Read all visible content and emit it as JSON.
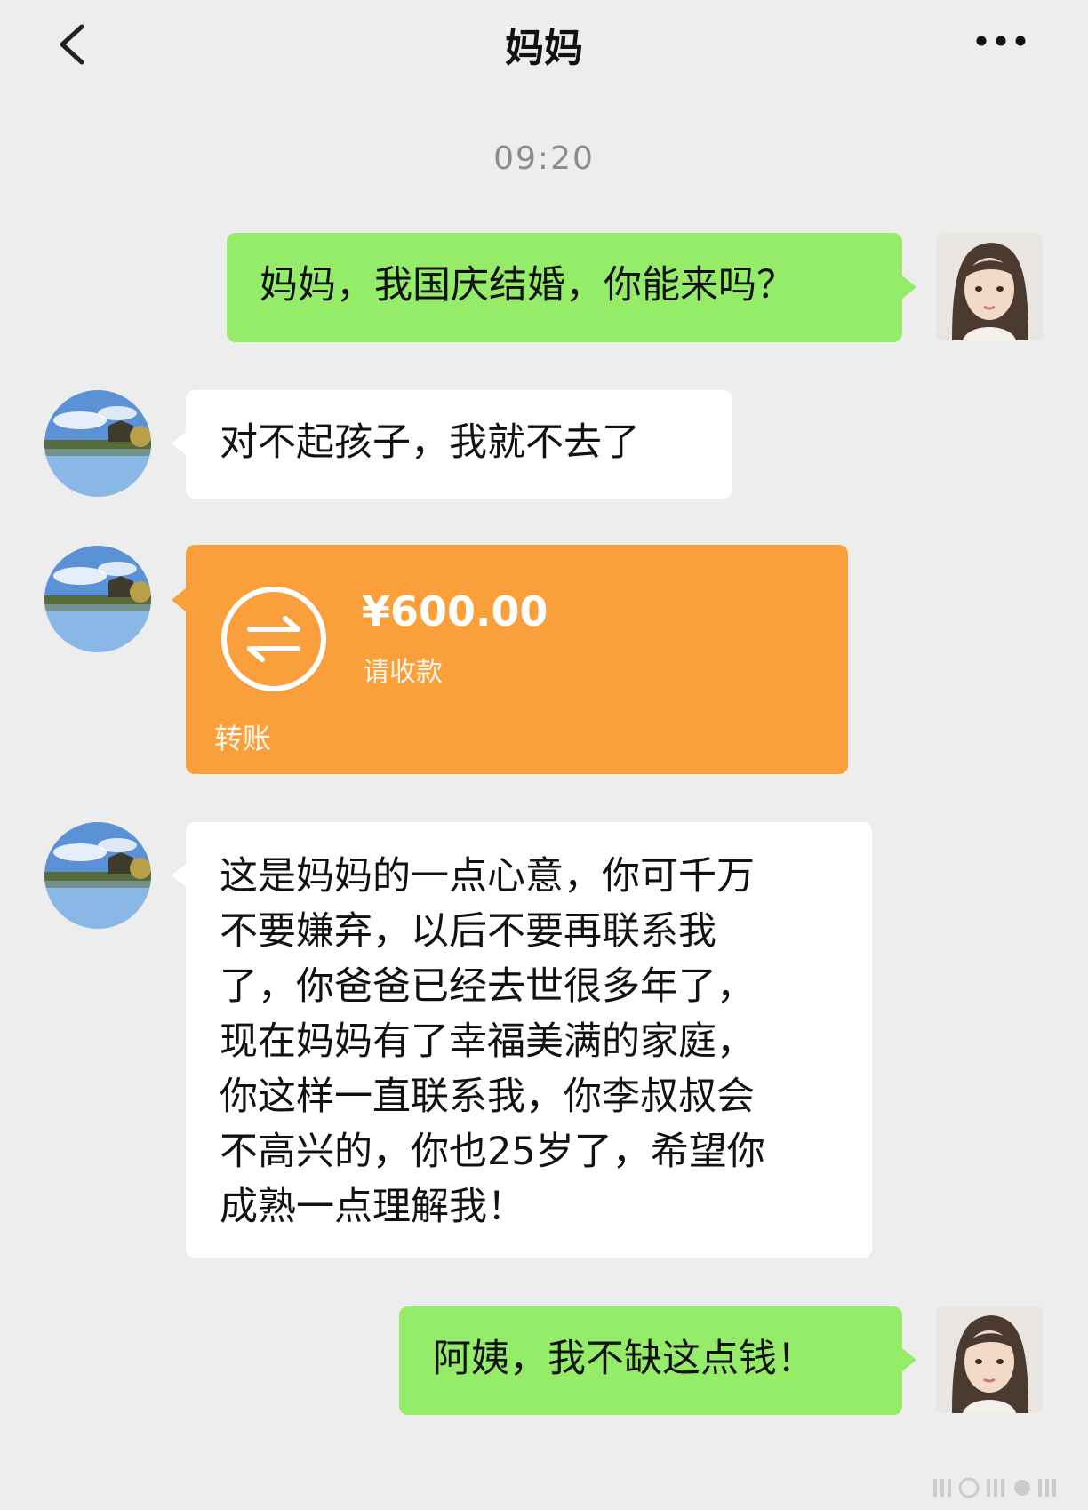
{
  "header": {
    "title": "妈妈",
    "back_icon": "chevron-left-icon",
    "more_icon": "more-horizontal-icon"
  },
  "timestamp": "09:20",
  "messages": [
    {
      "sender": "me",
      "type": "text",
      "text": "妈妈，我国庆结婚，你能来吗？"
    },
    {
      "sender": "mom",
      "type": "text",
      "text": "对不起孩子，我就不去了"
    },
    {
      "sender": "mom",
      "type": "transfer",
      "amount": "¥600.00",
      "status": "请收款",
      "label": "转账",
      "icon": "transfer-arrows-icon"
    },
    {
      "sender": "mom",
      "type": "text",
      "lines": [
        "这是妈妈的一点心意，你可千万",
        "不要嫌弃，以后不要再联系我",
        "了，你爸爸已经去世很多年了，",
        "现在妈妈有了幸福美满的家庭，",
        "你这样一直联系我，你李叔叔会",
        "不高兴的，你也25岁了，希望你",
        "成熟一点理解我！"
      ]
    },
    {
      "sender": "me",
      "type": "text",
      "text": "阿姨，我不缺这点钱！"
    }
  ],
  "colors": {
    "background": "#ededed",
    "my_bubble": "#95ec69",
    "their_bubble": "#ffffff",
    "transfer_card": "#f9a03c"
  }
}
